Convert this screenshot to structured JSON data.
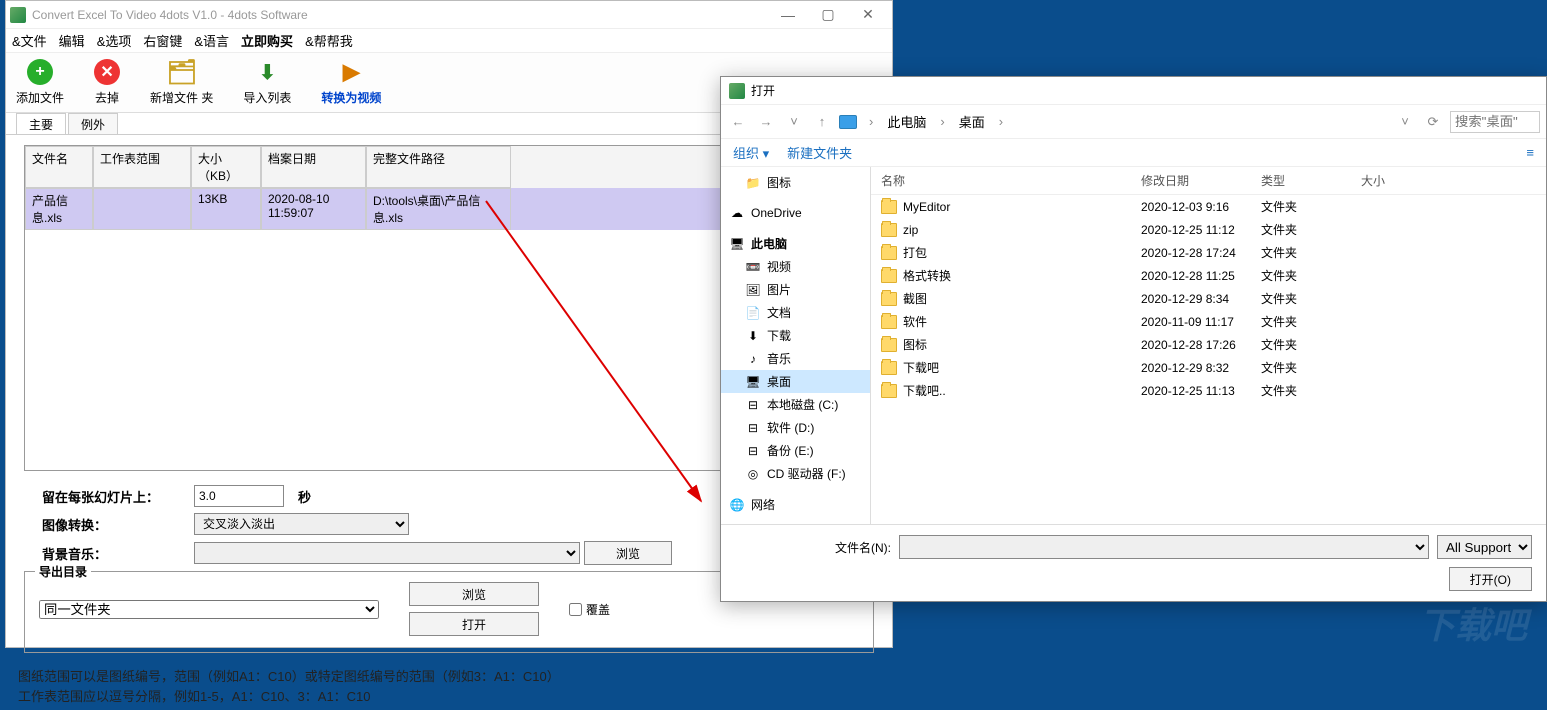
{
  "window": {
    "title": "Convert Excel To Video 4dots V1.0 - 4dots Software",
    "menu": [
      "&文件",
      "编辑",
      "&选项",
      "右窗键",
      "&语言",
      "立即购买",
      "&帮帮我"
    ],
    "menu_bold_index": 5,
    "tools": {
      "add": "添加文件",
      "remove": "去掉",
      "newfolder": "新增文件 夹",
      "import": "导入列表",
      "convert": "转换为视频"
    },
    "tabs": {
      "main": "主要",
      "exclude": "例外"
    }
  },
  "grid": {
    "headers": {
      "name": "文件名",
      "range": "工作表范围",
      "size": "大小（KB）",
      "date": "档案日期",
      "path": "完整文件路径"
    },
    "row": {
      "name": "产品信息.xls",
      "range": "",
      "size": "13KB",
      "date": "2020-08-10 11:59:07",
      "path": "D:\\tools\\桌面\\产品信息.xls"
    }
  },
  "form": {
    "stay_label": "留在每张幻灯片上：",
    "stay_value": "3.0",
    "seconds": "秒",
    "transition_label": "图像转换：",
    "transition_value": "交叉淡入淡出",
    "bgm_label": "背景音乐：",
    "bgm_value": "",
    "browse": "浏览",
    "outdir_legend": "导出目录",
    "outdir_value": "同一文件夹",
    "browse2": "浏览",
    "open": "打开",
    "overwrite": "覆盖"
  },
  "hints": {
    "l1": "图纸范围可以是图纸编号，范围（例如A1：C10）或特定图纸编号的范围（例如3：A1：C10）",
    "l2": "工作表范围应以逗号分隔，例如1-5，A1：C10、3：A1：C10"
  },
  "dialog": {
    "title": "打开",
    "crumbs": [
      "此电脑",
      "桌面"
    ],
    "search_placeholder": "搜索\"桌面\"",
    "organize": "组织 ▾",
    "newfolder": "新建文件夹",
    "side": [
      {
        "label": "图标",
        "lvl": 2,
        "ico": "📁"
      },
      {
        "label": "OneDrive",
        "lvl": 1,
        "ico": "☁"
      },
      {
        "label": "此电脑",
        "lvl": 1,
        "ico": "🖥",
        "bold": true
      },
      {
        "label": "视频",
        "lvl": 2,
        "ico": "📼"
      },
      {
        "label": "图片",
        "lvl": 2,
        "ico": "🖼"
      },
      {
        "label": "文档",
        "lvl": 2,
        "ico": "📄"
      },
      {
        "label": "下载",
        "lvl": 2,
        "ico": "⬇"
      },
      {
        "label": "音乐",
        "lvl": 2,
        "ico": "♪"
      },
      {
        "label": "桌面",
        "lvl": 2,
        "ico": "🖥",
        "sel": true
      },
      {
        "label": "本地磁盘 (C:)",
        "lvl": 2,
        "ico": "⊟"
      },
      {
        "label": "软件 (D:)",
        "lvl": 2,
        "ico": "⊟"
      },
      {
        "label": "备份 (E:)",
        "lvl": 2,
        "ico": "⊟"
      },
      {
        "label": "CD 驱动器 (F:)",
        "lvl": 2,
        "ico": "◎"
      },
      {
        "label": "网络",
        "lvl": 1,
        "ico": "🌐"
      }
    ],
    "col": {
      "name": "名称",
      "date": "修改日期",
      "type": "类型",
      "size": "大小"
    },
    "files": [
      {
        "name": "MyEditor",
        "date": "2020-12-03 9:16",
        "type": "文件夹"
      },
      {
        "name": "zip",
        "date": "2020-12-25 11:12",
        "type": "文件夹"
      },
      {
        "name": "打包",
        "date": "2020-12-28 17:24",
        "type": "文件夹"
      },
      {
        "name": "格式转换",
        "date": "2020-12-28 11:25",
        "type": "文件夹"
      },
      {
        "name": "截图",
        "date": "2020-12-29 8:34",
        "type": "文件夹"
      },
      {
        "name": "软件",
        "date": "2020-11-09 11:17",
        "type": "文件夹"
      },
      {
        "name": "图标",
        "date": "2020-12-28 17:26",
        "type": "文件夹"
      },
      {
        "name": "下载吧",
        "date": "2020-12-29 8:32",
        "type": "文件夹"
      },
      {
        "name": "下载吧..",
        "date": "2020-12-25 11:13",
        "type": "文件夹"
      }
    ],
    "filename_label": "文件名(N):",
    "filename_value": "",
    "filter": "All Supported A",
    "open_btn": "打开(O)"
  },
  "watermark": "下载吧"
}
